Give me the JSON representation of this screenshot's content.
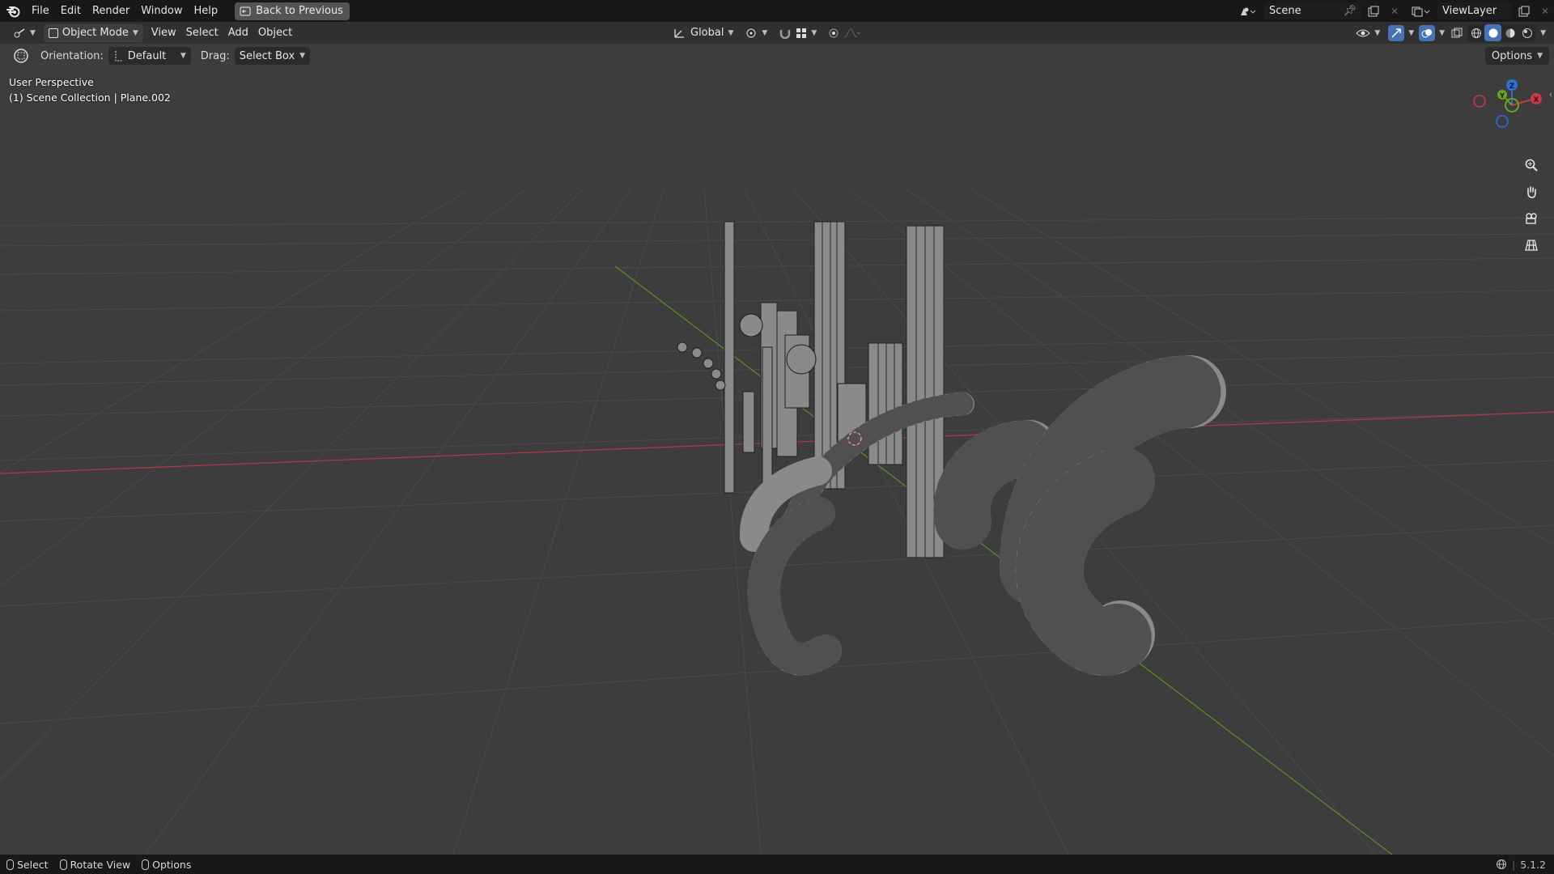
{
  "topbar": {
    "menus": [
      "File",
      "Edit",
      "Render",
      "Window",
      "Help"
    ],
    "back_button": "Back to Previous",
    "scene_name": "Scene",
    "view_layer": "ViewLayer"
  },
  "header": {
    "mode": "Object Mode",
    "menus": [
      "View",
      "Select",
      "Add",
      "Object"
    ],
    "transform_orientation": "Global"
  },
  "toolrow": {
    "orientation_label": "Orientation:",
    "orientation_value": "Default",
    "drag_label": "Drag:",
    "drag_value": "Select Box",
    "options": "Options"
  },
  "viewport": {
    "perspective": "User Perspective",
    "collection": "(1) Scene Collection | Plane.002",
    "gizmo": {
      "x": "X",
      "y": "Y",
      "z": "Z"
    }
  },
  "statusbar": {
    "select": "Select",
    "rotate": "Rotate View",
    "options": "Options",
    "version": "5.1.2"
  },
  "colors": {
    "x_axis": "#c8394a",
    "y_axis": "#6ba121",
    "z_axis": "#2f6fd4",
    "active": "#4772b3"
  }
}
